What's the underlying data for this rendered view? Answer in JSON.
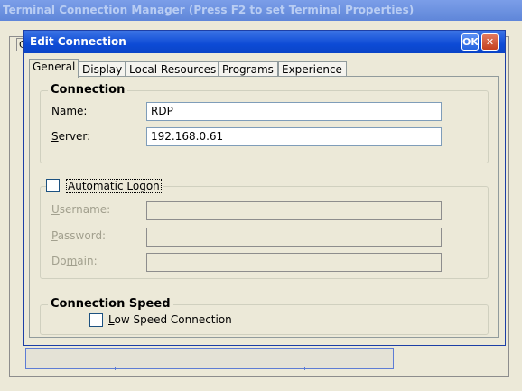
{
  "background": {
    "title": "Terminal Connection Manager (Press F2 to set Terminal Properties)",
    "tab_stub": "C"
  },
  "dialog": {
    "title": "Edit Connection",
    "ok_label": "OK",
    "close_glyph": "✕",
    "tabs": [
      "General",
      "Display",
      "Local Resources",
      "Programs",
      "Experience"
    ],
    "active_tab": "General"
  },
  "connection": {
    "legend": "Connection",
    "name_label": "Name:",
    "name_value": "RDP",
    "server_label": "Server:",
    "server_value": "192.168.0.61"
  },
  "logon": {
    "checkbox_label": "Automatic Logon",
    "checked": false,
    "username_label": "Username:",
    "username_value": "",
    "password_label": "Password:",
    "password_value": "",
    "domain_label": "Domain:",
    "domain_value": ""
  },
  "speed": {
    "legend": "Connection Speed",
    "checkbox_label": "Low Speed Connection",
    "checked": false
  },
  "colors": {
    "window_bg": "#ece9d8",
    "title_blue": "#0d4bd6",
    "close_red": "#c3401f"
  }
}
